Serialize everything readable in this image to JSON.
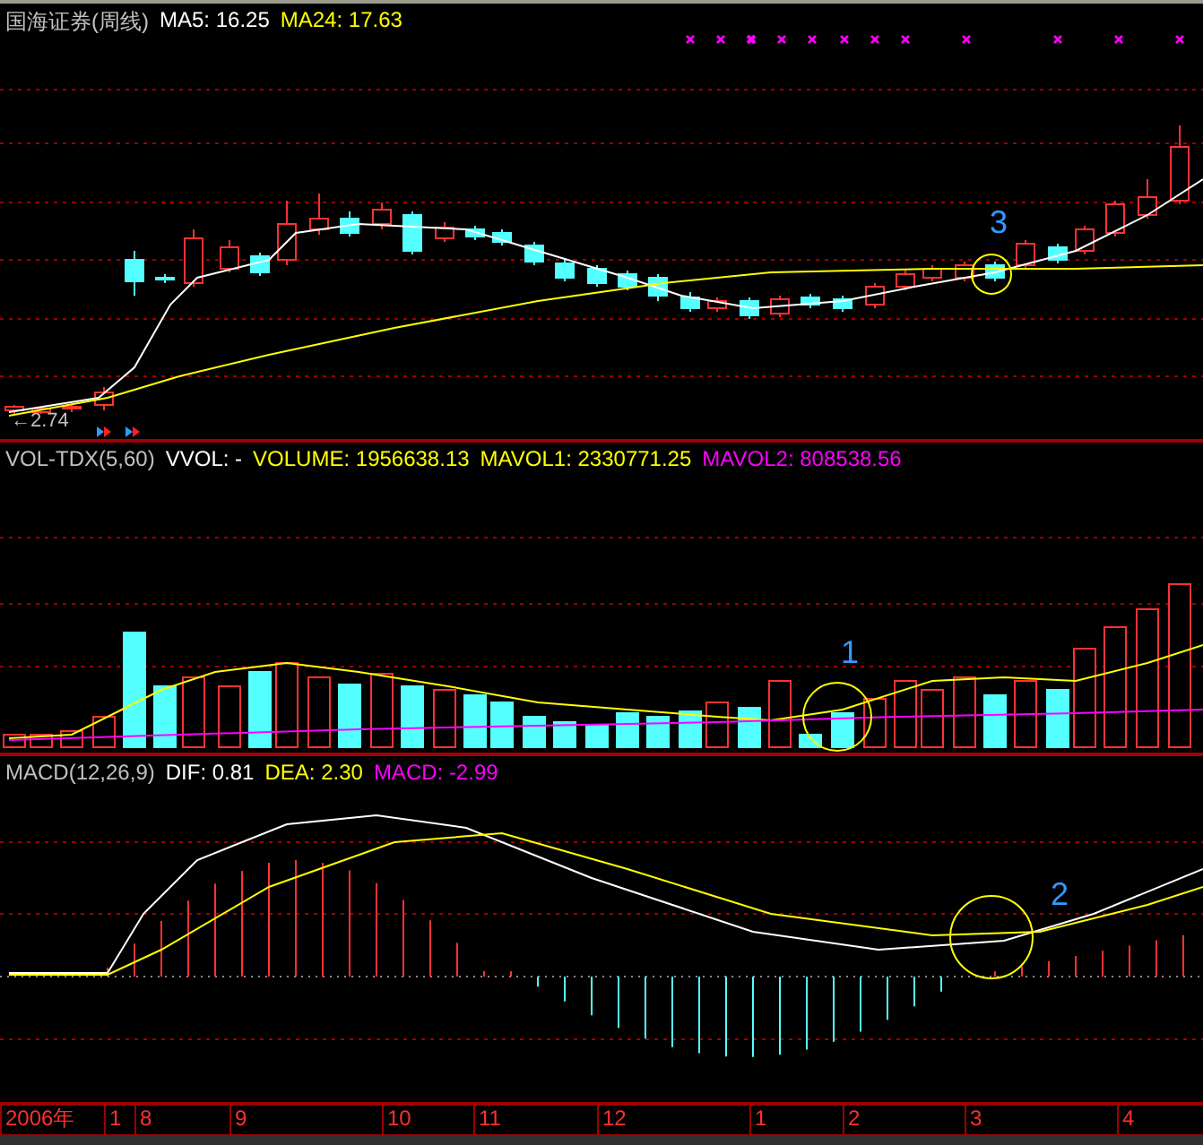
{
  "chart_title": {
    "name": "国海证券(周线)",
    "ma5": "MA5: 16.25",
    "ma24": "MA24: 17.63"
  },
  "price_pane": {
    "low_marker": "←2.74",
    "annotation": "3"
  },
  "volume_pane": {
    "indicator": "VOL-TDX(5,60)",
    "vvol": "VVOL: -",
    "volume": "VOLUME: 1956638.13",
    "mavol1": "MAVOL1: 2330771.25",
    "mavol2": "MAVOL2: 808538.56",
    "annotation": "1"
  },
  "macd_pane": {
    "indicator": "MACD(12,26,9)",
    "dif": "DIF: 0.81",
    "dea": "DEA: 2.30",
    "macd": "MACD: -2.99",
    "annotation": "2"
  },
  "time_axis": [
    "2006年",
    "1",
    "8",
    "9",
    "10",
    "11",
    "12",
    "1",
    "2",
    "3",
    "4"
  ]
}
